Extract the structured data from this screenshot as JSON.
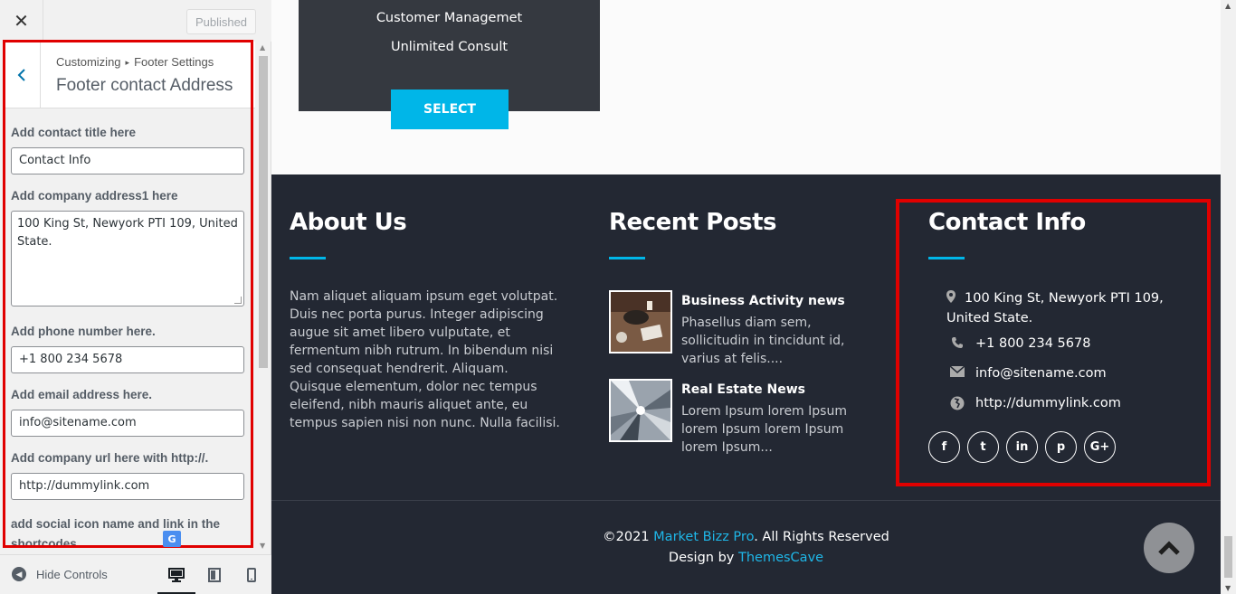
{
  "sidebar": {
    "close_label": "✕",
    "published_label": "Published",
    "breadcrumb_root": "Customizing",
    "breadcrumb_sep": "▸",
    "breadcrumb_parent": "Footer Settings",
    "section_title": "Footer contact Address",
    "fields": {
      "title_label": "Add contact title here",
      "title_value": "Contact Info",
      "address_label": "Add company address1 here",
      "address_value": "100 King St, Newyork PTI 109, United State.",
      "phone_label": "Add phone number here.",
      "phone_value": "+1 800 234 5678",
      "email_label": "Add email address here.",
      "email_value": "info@sitename.com",
      "url_label": "Add company url here with http://.",
      "url_value": "http://dummylink.com",
      "social_label": "add social icon name and link in the shortcodes"
    },
    "hide_controls_label": "Hide Controls"
  },
  "preview": {
    "plan_lines": [
      "Customer Managemet",
      "Unlimited Consult"
    ],
    "select_label": "SELECT",
    "about": {
      "heading": "About Us",
      "text": "Nam aliquet aliquam ipsum eget volutpat. Duis nec porta purus. Integer adipiscing augue sit amet libero vulputate, et fermentum nibh rutrum. In bibendum nisi sed consequat hendrerit. Aliquam. Quisque elementum, dolor nec tempus eleifend, nibh mauris aliquet ante, eu tempus sapien nisi non nunc. Nulla facilisi."
    },
    "recent": {
      "heading": "Recent Posts",
      "posts": [
        {
          "title": "Business Activity news",
          "excerpt": "Phasellus diam sem, sollicitudin in tincidunt id, varius at felis...."
        },
        {
          "title": "Real Estate News",
          "excerpt": "Lorem Ipsum lorem Ipsum lorem Ipsum lorem Ipsum lorem Ipsum..."
        }
      ]
    },
    "contact": {
      "heading": "Contact Info",
      "address": "100 King St, Newyork PTI 109, United State.",
      "phone": "+1 800 234 5678",
      "email": "info@sitename.com",
      "url": "http://dummylink.com",
      "social": [
        "f",
        "t",
        "in",
        "p",
        "G+"
      ]
    },
    "copyright_pre": "©2021 ",
    "copyright_link": "Market Bizz Pro",
    "copyright_post": ". All Rights Reserved",
    "design_pre": "Design by ",
    "design_link": "ThemesCave"
  },
  "colors": {
    "accent": "#00b6e8",
    "footer_bg": "#232833",
    "highlight": "#e00000"
  }
}
